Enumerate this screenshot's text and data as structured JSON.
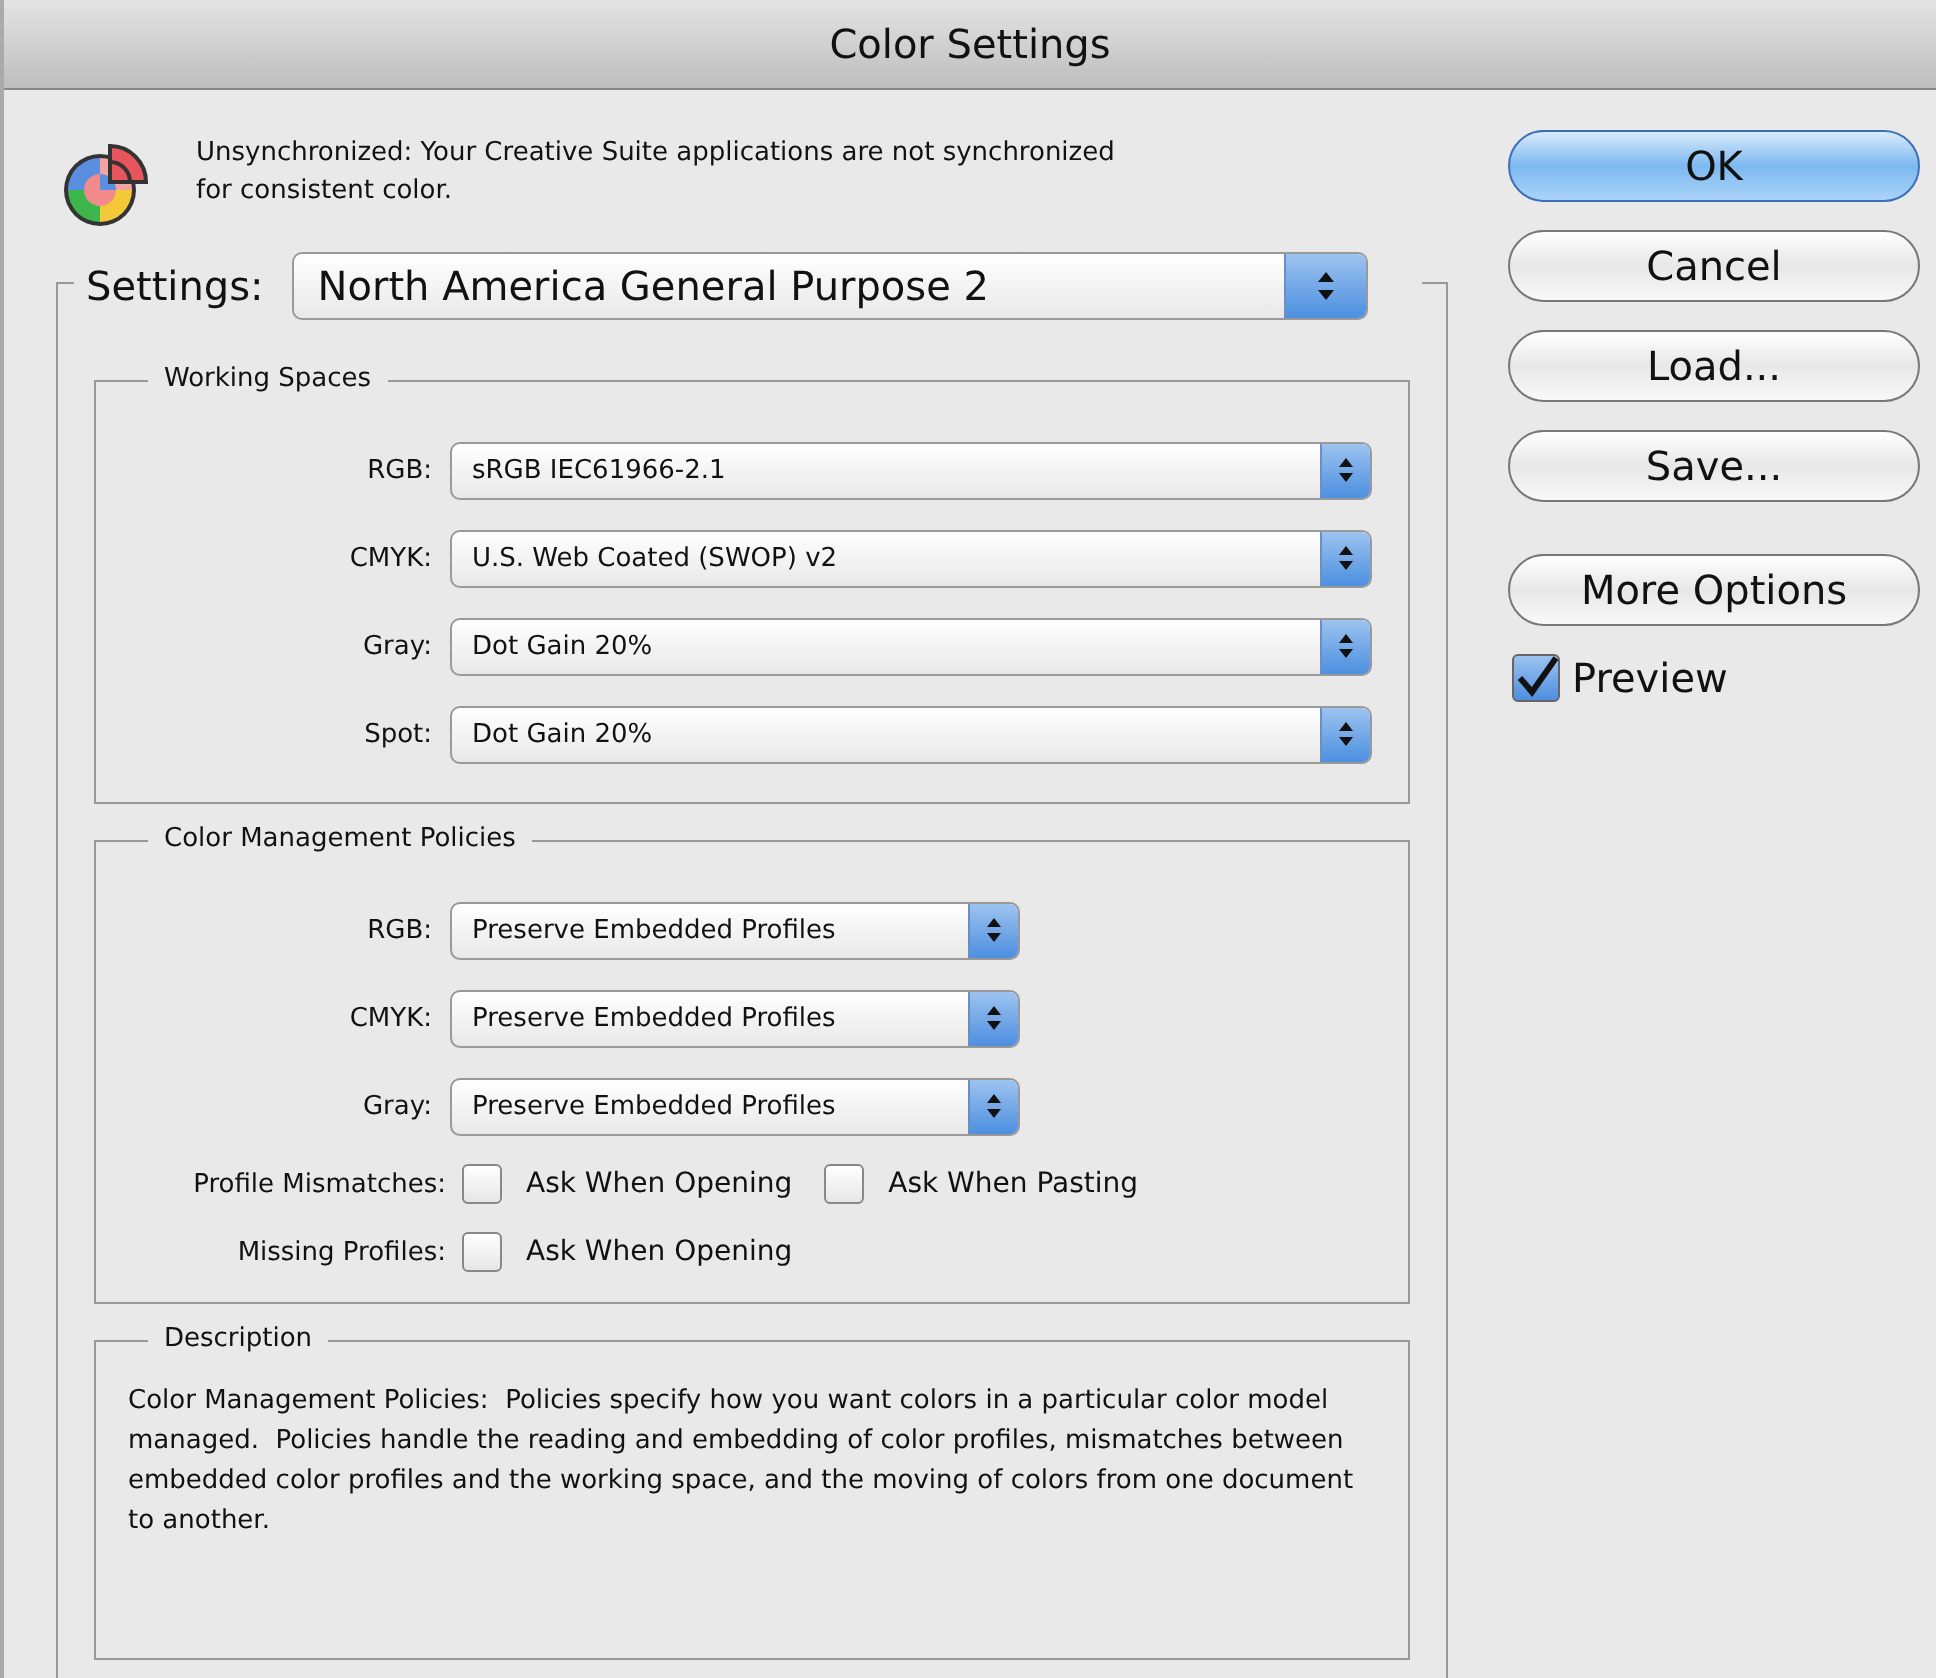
{
  "window": {
    "title": "Color Settings"
  },
  "sync_message": "Unsynchronized: Your Creative Suite applications are not synchronized for consistent color.",
  "settings": {
    "label": "Settings:",
    "value": "North America General Purpose 2"
  },
  "working_spaces": {
    "title": "Working Spaces",
    "rows": [
      {
        "label": "RGB:",
        "value": "sRGB IEC61966-2.1"
      },
      {
        "label": "CMYK:",
        "value": "U.S. Web Coated (SWOP) v2"
      },
      {
        "label": "Gray:",
        "value": "Dot Gain 20%"
      },
      {
        "label": "Spot:",
        "value": "Dot Gain 20%"
      }
    ]
  },
  "policies": {
    "title": "Color Management Policies",
    "rows": [
      {
        "label": "RGB:",
        "value": "Preserve Embedded Profiles"
      },
      {
        "label": "CMYK:",
        "value": "Preserve Embedded Profiles"
      },
      {
        "label": "Gray:",
        "value": "Preserve Embedded Profiles"
      }
    ],
    "check_rows": [
      {
        "label": "Profile Mismatches:",
        "options": [
          {
            "label": "Ask When Opening",
            "checked": false
          },
          {
            "label": "Ask When Pasting",
            "checked": false
          }
        ]
      },
      {
        "label": "Missing Profiles:",
        "options": [
          {
            "label": "Ask When Opening",
            "checked": false
          }
        ]
      }
    ]
  },
  "description": {
    "title": "Description",
    "text": "Color Management Policies:  Policies specify how you want colors in a particular color model managed.  Policies handle the reading and embedding of color profiles, mismatches between embedded color profiles and the working space, and the moving of colors from one document to another."
  },
  "buttons": [
    {
      "label": "OK",
      "default": true
    },
    {
      "label": "Cancel",
      "default": false
    },
    {
      "label": "Load...",
      "default": false
    },
    {
      "label": "Save...",
      "default": false
    }
  ],
  "more_options": {
    "label": "More Options"
  },
  "preview": {
    "label": "Preview",
    "checked": true
  }
}
